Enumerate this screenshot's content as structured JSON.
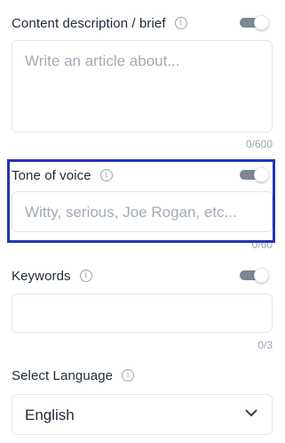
{
  "content_brief": {
    "label": "Content description / brief",
    "placeholder": "Write an article about...",
    "counter": "0/600",
    "toggle_on": true
  },
  "tone": {
    "label": "Tone of voice",
    "placeholder": "Witty, serious, Joe Rogan, etc...",
    "counter": "0/60",
    "toggle_on": true
  },
  "keywords": {
    "label": "Keywords",
    "value": "",
    "counter": "0/3",
    "toggle_on": true
  },
  "language": {
    "label": "Select Language",
    "selected": "English"
  },
  "colors": {
    "highlight_border": "#2236b4",
    "toggle_track": "#7c8694",
    "placeholder_text": "#a3abb5"
  },
  "icons": {
    "info": "info-icon",
    "dropdown": "chevron-down-icon"
  }
}
